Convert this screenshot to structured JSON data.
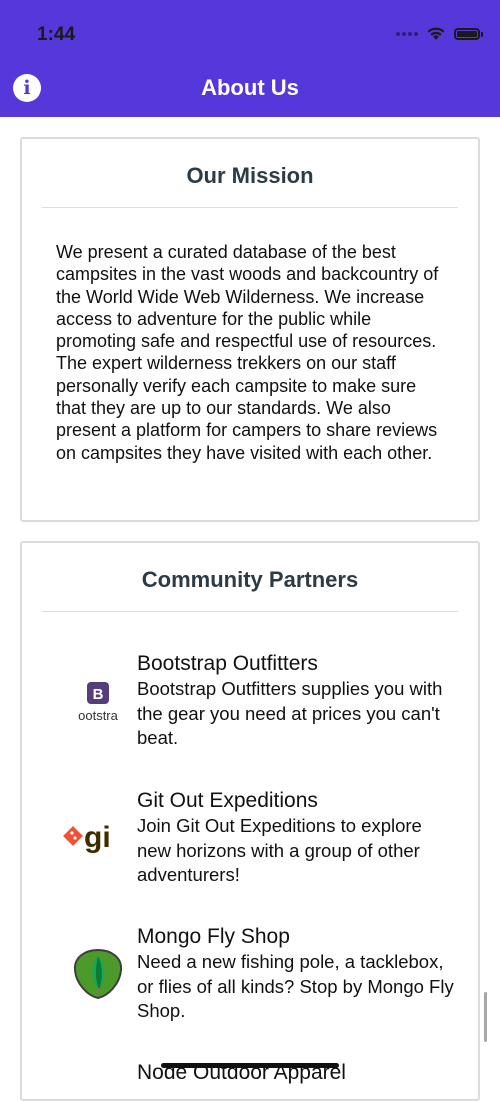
{
  "status_bar": {
    "time": "1:44",
    "icons": [
      "signal-dots-icon",
      "wifi-icon",
      "battery-icon"
    ]
  },
  "nav_bar": {
    "title": "About Us",
    "left_icon": "info-icon",
    "left_icon_glyph": "i"
  },
  "mission": {
    "title": "Our Mission",
    "body": "We present a curated database of the best campsites in the vast woods and backcountry of the World Wide Web Wilderness. We increase access to adventure for the public while promoting safe and respectful use of resources. The expert wilderness trekkers on our staff personally verify each campsite to make sure that they are up to our standards. We also present a platform for campers to share reviews on campsites they have visited with each other."
  },
  "partners": {
    "title": "Community Partners",
    "items": [
      {
        "name": "Bootstrap Outfitters",
        "description": "Bootstrap Outfitters supplies you with the gear you need at prices you can't beat.",
        "logo_icon": "bootstrap-logo-icon",
        "logo_text": "ootstra",
        "logo_glyph": "B"
      },
      {
        "name": "Git Out Expeditions",
        "description": "Join Git Out Expeditions to explore new horizons with a group of other adventurers!",
        "logo_icon": "git-logo-icon",
        "logo_text": "gi"
      },
      {
        "name": "Mongo Fly Shop",
        "description": "Need a new fishing pole, a tacklebox, or flies of all kinds? Stop by Mongo Fly Shop.",
        "logo_icon": "mongodb-leaf-logo-icon"
      },
      {
        "name": "Node Outdoor Apparel"
      }
    ]
  },
  "colors": {
    "accent": "#5637d9",
    "card_border": "#dcdcdc",
    "title_text": "#2d3b45"
  }
}
